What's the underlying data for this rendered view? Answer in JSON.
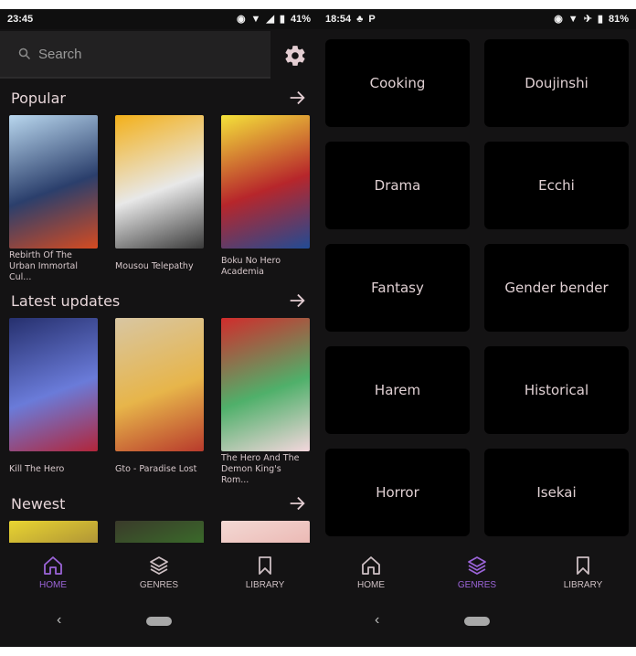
{
  "left_screen": {
    "status": {
      "time": "23:45",
      "battery": "41%"
    },
    "search": {
      "placeholder": "Search"
    },
    "sections": [
      {
        "title": "Popular",
        "items": [
          {
            "title": "Rebirth Of The Urban Immortal Cul...",
            "cover_colors": [
              "#b9d7ee",
              "#2b3f6c",
              "#d54b21"
            ]
          },
          {
            "title": "Mousou Telepathy",
            "cover_colors": [
              "#f3b019",
              "#e8e8e8",
              "#3b3b3b"
            ]
          },
          {
            "title": "Boku No Hero Academia",
            "cover_colors": [
              "#f4e23a",
              "#b7262b",
              "#214b94"
            ]
          }
        ]
      },
      {
        "title": "Latest updates",
        "items": [
          {
            "title": "Kill The Hero",
            "cover_colors": [
              "#26306e",
              "#6a7bd9",
              "#b2253a"
            ]
          },
          {
            "title": "Gto - Paradise Lost",
            "cover_colors": [
              "#d8c6a2",
              "#e7b54a",
              "#b83a2c"
            ]
          },
          {
            "title": "The Hero And The Demon King's Rom...",
            "cover_colors": [
              "#d12c2c",
              "#4fb06a",
              "#f4d7dd"
            ]
          }
        ]
      },
      {
        "title": "Newest",
        "items": [
          {
            "title": "",
            "cover_colors": [
              "#e9d531",
              "#8a6a3a",
              "#e9d531"
            ]
          },
          {
            "title": "",
            "cover_colors": [
              "#3a3a2a",
              "#3a8a2a",
              "#1b1b1b"
            ]
          },
          {
            "title": "",
            "cover_colors": [
              "#f3d9d4",
              "#e7a4a0",
              "#f7eeee"
            ]
          }
        ]
      }
    ],
    "nav": {
      "active": "home"
    }
  },
  "right_screen": {
    "status": {
      "time": "18:54",
      "battery": "81%"
    },
    "genres": [
      "Cooking",
      "Doujinshi",
      "Drama",
      "Ecchi",
      "Fantasy",
      "Gender bender",
      "Harem",
      "Historical",
      "Horror",
      "Isekai"
    ],
    "nav": {
      "active": "genres"
    }
  },
  "nav_labels": {
    "home": "HOME",
    "genres": "GENRES",
    "library": "LIBRARY"
  },
  "sysnav": {
    "back": "‹"
  },
  "colors": {
    "accent": "#9b64d8",
    "text": "#e7d6d9",
    "background": "#141314",
    "tile": "#000000",
    "icon_inactive": "#cdbfc3"
  }
}
